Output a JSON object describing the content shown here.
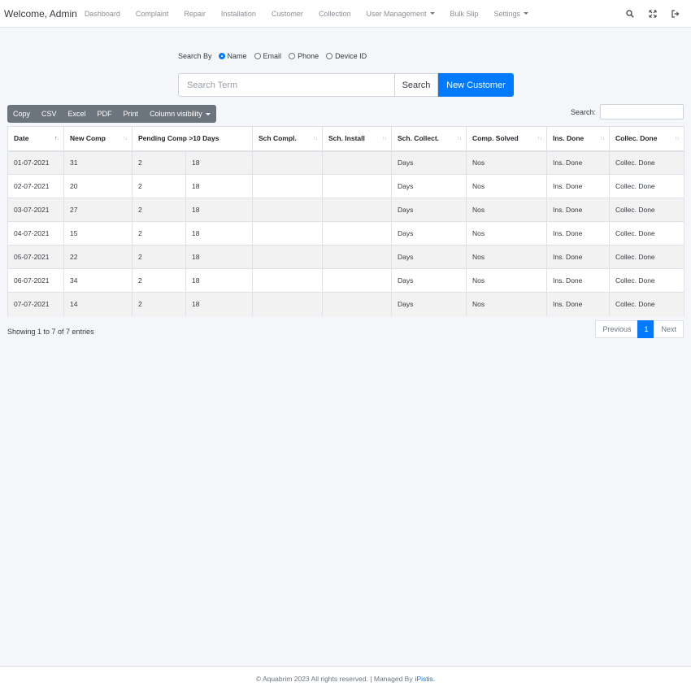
{
  "navbar": {
    "brand": "Welcome, Admin",
    "items": [
      {
        "label": "Dashboard"
      },
      {
        "label": "Complaint"
      },
      {
        "label": "Repair"
      },
      {
        "label": "Installation"
      },
      {
        "label": "Customer"
      },
      {
        "label": "Collection"
      },
      {
        "label": "User Management"
      },
      {
        "label": "Bulk Slip"
      },
      {
        "label": "Settings"
      }
    ],
    "icons": [
      "search-icon",
      "fullscreen-icon",
      "logout-icon"
    ]
  },
  "search_by": {
    "label": "Search By",
    "options": [
      {
        "label": "Name",
        "checked": true
      },
      {
        "label": "Email",
        "checked": false
      },
      {
        "label": "Phone",
        "checked": false
      },
      {
        "label": "Device ID",
        "checked": false
      }
    ]
  },
  "search": {
    "placeholder": "Search Term",
    "search_label": "Search",
    "new_customer_label": "New Customer"
  },
  "export_buttons": {
    "copy": "Copy",
    "csv": "CSV",
    "excel": "Excel",
    "pdf": "PDF",
    "print": "Print",
    "column_visibility": "Column visibility"
  },
  "table_search": {
    "label": "Search:"
  },
  "table": {
    "headers": {
      "date": "Date",
      "new_comp": "New Comp",
      "pending": "Pending Comp >10 Days",
      "sch_compl": "Sch Compl.",
      "sch_install": "Sch. Install",
      "sch_collect": "Sch. Collect.",
      "comp_solved": "Comp. Solved",
      "ins_done": "Ins. Done",
      "collec_done": "Collec. Done"
    },
    "rows": [
      {
        "date": "01-07-2021",
        "new_comp": "31",
        "p1": "2",
        "p2": "18",
        "sch_compl": "",
        "sch_install": "",
        "sch_collect": "Days",
        "comp_solved": "Nos",
        "ins_done": "Ins. Done",
        "collec_done": "Collec. Done"
      },
      {
        "date": "02-07-2021",
        "new_comp": "20",
        "p1": "2",
        "p2": "18",
        "sch_compl": "",
        "sch_install": "",
        "sch_collect": "Days",
        "comp_solved": "Nos",
        "ins_done": "Ins. Done",
        "collec_done": "Collec. Done"
      },
      {
        "date": "03-07-2021",
        "new_comp": "27",
        "p1": "2",
        "p2": "18",
        "sch_compl": "",
        "sch_install": "",
        "sch_collect": "Days",
        "comp_solved": "Nos",
        "ins_done": "Ins. Done",
        "collec_done": "Collec. Done"
      },
      {
        "date": "04-07-2021",
        "new_comp": "15",
        "p1": "2",
        "p2": "18",
        "sch_compl": "",
        "sch_install": "",
        "sch_collect": "Days",
        "comp_solved": "Nos",
        "ins_done": "Ins. Done",
        "collec_done": "Collec. Done"
      },
      {
        "date": "05-07-2021",
        "new_comp": "22",
        "p1": "2",
        "p2": "18",
        "sch_compl": "",
        "sch_install": "",
        "sch_collect": "Days",
        "comp_solved": "Nos",
        "ins_done": "Ins. Done",
        "collec_done": "Collec. Done"
      },
      {
        "date": "06-07-2021",
        "new_comp": "34",
        "p1": "2",
        "p2": "18",
        "sch_compl": "",
        "sch_install": "",
        "sch_collect": "Days",
        "comp_solved": "Nos",
        "ins_done": "Ins. Done",
        "collec_done": "Collec. Done"
      },
      {
        "date": "07-07-2021",
        "new_comp": "14",
        "p1": "2",
        "p2": "18",
        "sch_compl": "",
        "sch_install": "",
        "sch_collect": "Days",
        "comp_solved": "Nos",
        "ins_done": "Ins. Done",
        "collec_done": "Collec. Done"
      }
    ]
  },
  "info": "Showing 1 to 7 of 7 entries",
  "pagination": {
    "previous": "Previous",
    "page": "1",
    "next": "Next"
  },
  "footer": {
    "text": "© Aquabrim 2023 All rights reserved. | Managed By",
    "link": "iPistis."
  },
  "colors": {
    "primary": "#007bff",
    "secondary": "#6c757d",
    "background": "#f4f6f9"
  }
}
